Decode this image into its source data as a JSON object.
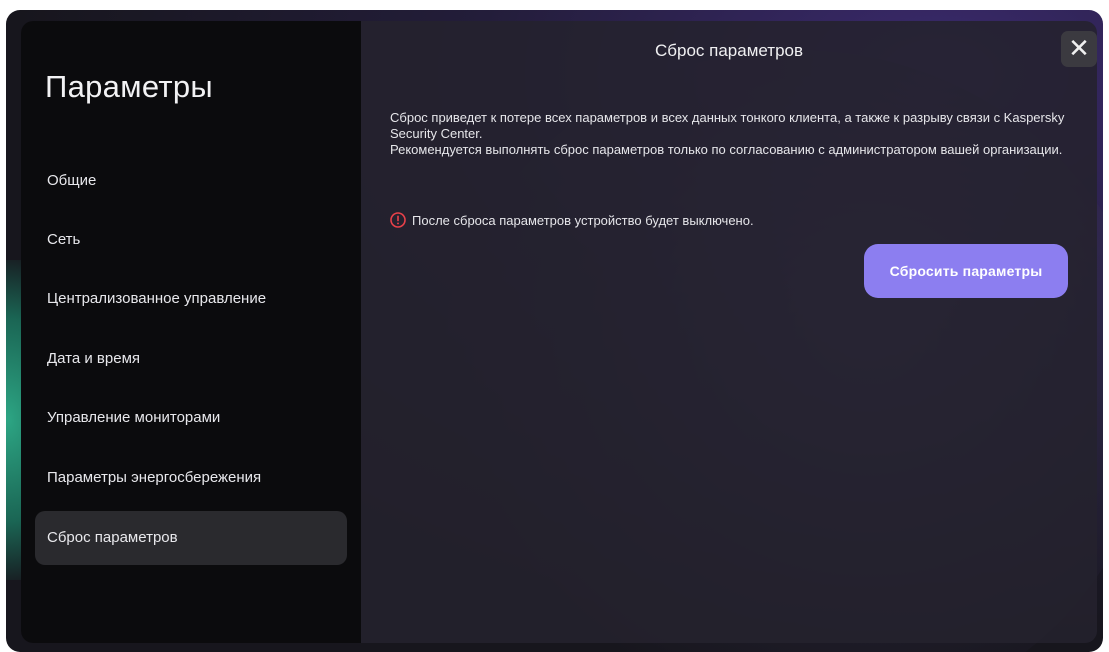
{
  "sidebar": {
    "title": "Параметры",
    "items": [
      {
        "label": "Общие"
      },
      {
        "label": "Сеть"
      },
      {
        "label": "Централизованное управление"
      },
      {
        "label": "Дата и время"
      },
      {
        "label": "Управление мониторами"
      },
      {
        "label": "Параметры энергосбережения"
      },
      {
        "label": "Сброс параметров",
        "active": true
      }
    ]
  },
  "content": {
    "title": "Сброс параметров",
    "close_icon": "close-icon",
    "description": [
      "Сброс приведет к потере всех параметров и всех данных тонкого клиента, а также к разрыву связи с Kaspersky Security Center.",
      "Рекомендуется выполнять сброс параметров только по согласованию с администратором вашей организации."
    ],
    "warning": {
      "icon": "warning-circle-icon",
      "text": "После сброса параметров устройство будет выключено."
    },
    "reset_button_label": "Сбросить параметры"
  },
  "colors": {
    "accent": "#8c7ef0",
    "warning": "#e8414a",
    "sidebar_bg": "#0b0b0d",
    "active_item_bg": "#2a2a2e"
  }
}
